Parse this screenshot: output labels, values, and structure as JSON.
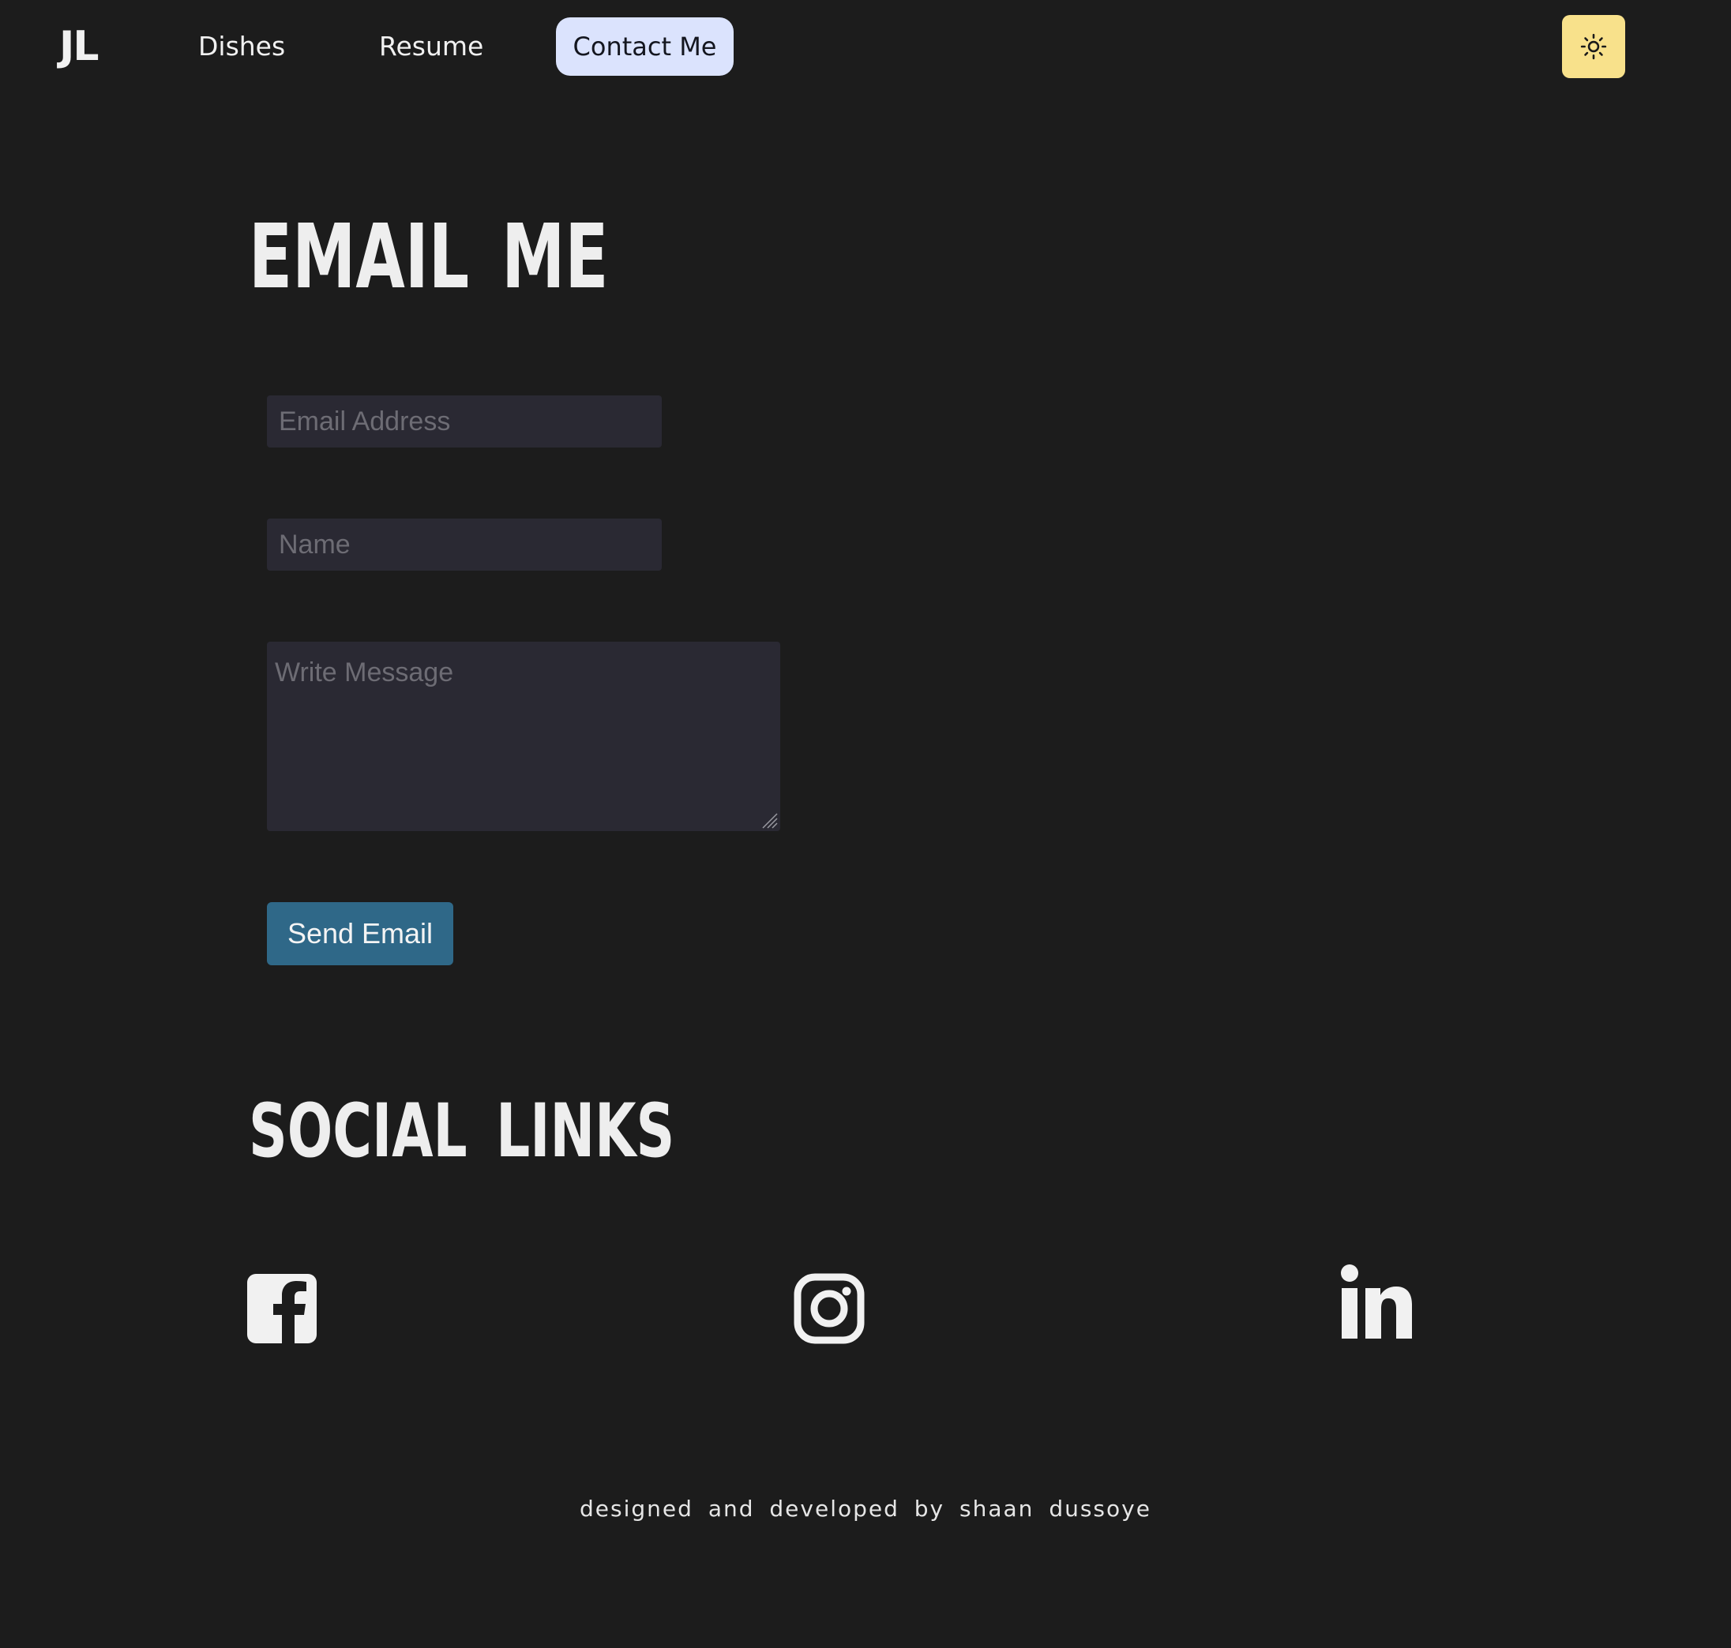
{
  "nav": {
    "logo": "JL",
    "links": [
      {
        "label": "Dishes"
      },
      {
        "label": "Resume"
      },
      {
        "label": "Contact Me"
      }
    ],
    "active": "Contact Me",
    "theme_toggle_icon": "sun-icon"
  },
  "email_section": {
    "heading": "EMAIL ME",
    "email_placeholder": "Email Address",
    "email_value": "",
    "name_placeholder": "Name",
    "name_value": "",
    "message_placeholder": "Write Message",
    "message_value": "",
    "submit_label": "Send Email"
  },
  "social_section": {
    "heading": "SOCIAL LINKS",
    "links": [
      {
        "icon": "facebook-icon"
      },
      {
        "icon": "instagram-icon"
      },
      {
        "icon": "linkedin-icon"
      }
    ]
  },
  "footer": {
    "text": "designed and developed by shaan dussoye"
  },
  "colors": {
    "background": "#1c1c1c",
    "active_nav_bg": "#dbe3fd",
    "theme_toggle_bg": "#f8e18b",
    "field_bg": "#2a2933",
    "button_bg": "#2f6888",
    "text": "#ececec"
  }
}
